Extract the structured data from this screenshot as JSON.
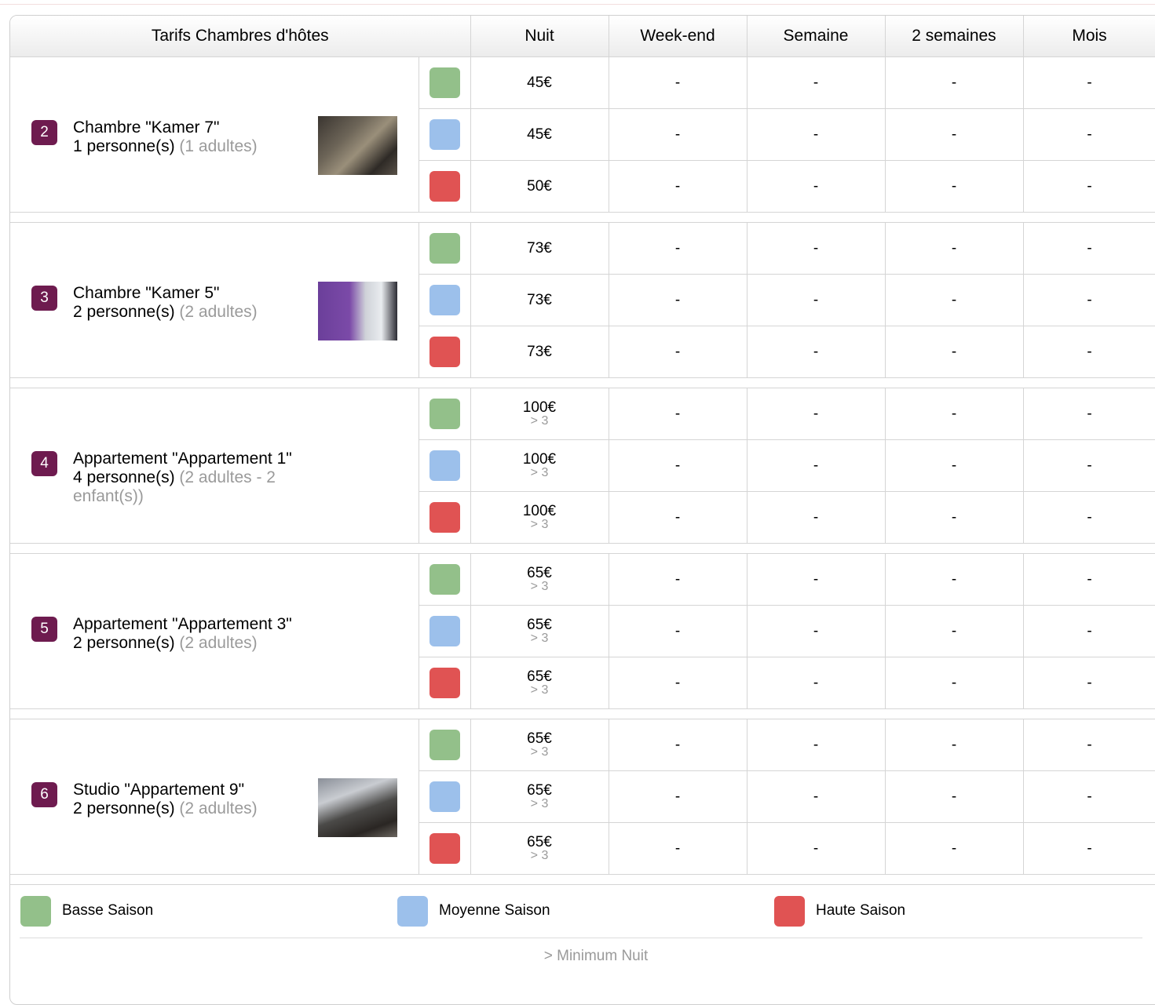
{
  "table": {
    "headers": [
      "Tarifs Chambres d'hôtes",
      "Nuit",
      "Week-end",
      "Semaine",
      "2 semaines",
      "Mois"
    ]
  },
  "colors": {
    "badge": "#6e1b4f",
    "basse": "#93c08a",
    "moyenne": "#9cc0eb",
    "haute": "#e05353"
  },
  "rooms": [
    {
      "number": "2",
      "name": "Chambre \"Kamer 7\"",
      "persons": "1 personne(s)",
      "detail": "(1 adultes)",
      "photo": "room-photo",
      "rates": [
        {
          "season": "basse",
          "night": "45€",
          "min": "",
          "weekend": "-",
          "week": "-",
          "two_weeks": "-",
          "month": "-"
        },
        {
          "season": "moyenne",
          "night": "45€",
          "min": "",
          "weekend": "-",
          "week": "-",
          "two_weeks": "-",
          "month": "-"
        },
        {
          "season": "haute",
          "night": "50€",
          "min": "",
          "weekend": "-",
          "week": "-",
          "two_weeks": "-",
          "month": "-"
        }
      ]
    },
    {
      "number": "3",
      "name": "Chambre \"Kamer 5\"",
      "persons": "2 personne(s)",
      "detail": "(2 adultes)",
      "photo": "room-photo",
      "rates": [
        {
          "season": "basse",
          "night": "73€",
          "min": "",
          "weekend": "-",
          "week": "-",
          "two_weeks": "-",
          "month": "-"
        },
        {
          "season": "moyenne",
          "night": "73€",
          "min": "",
          "weekend": "-",
          "week": "-",
          "two_weeks": "-",
          "month": "-"
        },
        {
          "season": "haute",
          "night": "73€",
          "min": "",
          "weekend": "-",
          "week": "-",
          "two_weeks": "-",
          "month": "-"
        }
      ]
    },
    {
      "number": "4",
      "name": "Appartement \"Appartement 1\"",
      "persons": "4 personne(s)",
      "detail": "(2 adultes - 2 enfant(s))",
      "photo": "",
      "rates": [
        {
          "season": "basse",
          "night": "100€",
          "min": "> 3",
          "weekend": "-",
          "week": "-",
          "two_weeks": "-",
          "month": "-"
        },
        {
          "season": "moyenne",
          "night": "100€",
          "min": "> 3",
          "weekend": "-",
          "week": "-",
          "two_weeks": "-",
          "month": "-"
        },
        {
          "season": "haute",
          "night": "100€",
          "min": "> 3",
          "weekend": "-",
          "week": "-",
          "two_weeks": "-",
          "month": "-"
        }
      ]
    },
    {
      "number": "5",
      "name": "Appartement \"Appartement 3\"",
      "persons": "2 personne(s)",
      "detail": "(2 adultes)",
      "photo": "",
      "rates": [
        {
          "season": "basse",
          "night": "65€",
          "min": "> 3",
          "weekend": "-",
          "week": "-",
          "two_weeks": "-",
          "month": "-"
        },
        {
          "season": "moyenne",
          "night": "65€",
          "min": "> 3",
          "weekend": "-",
          "week": "-",
          "two_weeks": "-",
          "month": "-"
        },
        {
          "season": "haute",
          "night": "65€",
          "min": "> 3",
          "weekend": "-",
          "week": "-",
          "two_weeks": "-",
          "month": "-"
        }
      ]
    },
    {
      "number": "6",
      "name": "Studio \"Appartement 9\"",
      "persons": "2 personne(s)",
      "detail": "(2 adultes)",
      "photo": "room-photo",
      "rates": [
        {
          "season": "basse",
          "night": "65€",
          "min": "> 3",
          "weekend": "-",
          "week": "-",
          "two_weeks": "-",
          "month": "-"
        },
        {
          "season": "moyenne",
          "night": "65€",
          "min": "> 3",
          "weekend": "-",
          "week": "-",
          "two_weeks": "-",
          "month": "-"
        },
        {
          "season": "haute",
          "night": "65€",
          "min": "> 3",
          "weekend": "-",
          "week": "-",
          "two_weeks": "-",
          "month": "-"
        }
      ]
    }
  ],
  "legend": {
    "items": [
      {
        "season": "basse",
        "label": "Basse Saison"
      },
      {
        "season": "moyenne",
        "label": "Moyenne Saison"
      },
      {
        "season": "haute",
        "label": "Haute Saison"
      }
    ],
    "note": "> Minimum Nuit"
  }
}
